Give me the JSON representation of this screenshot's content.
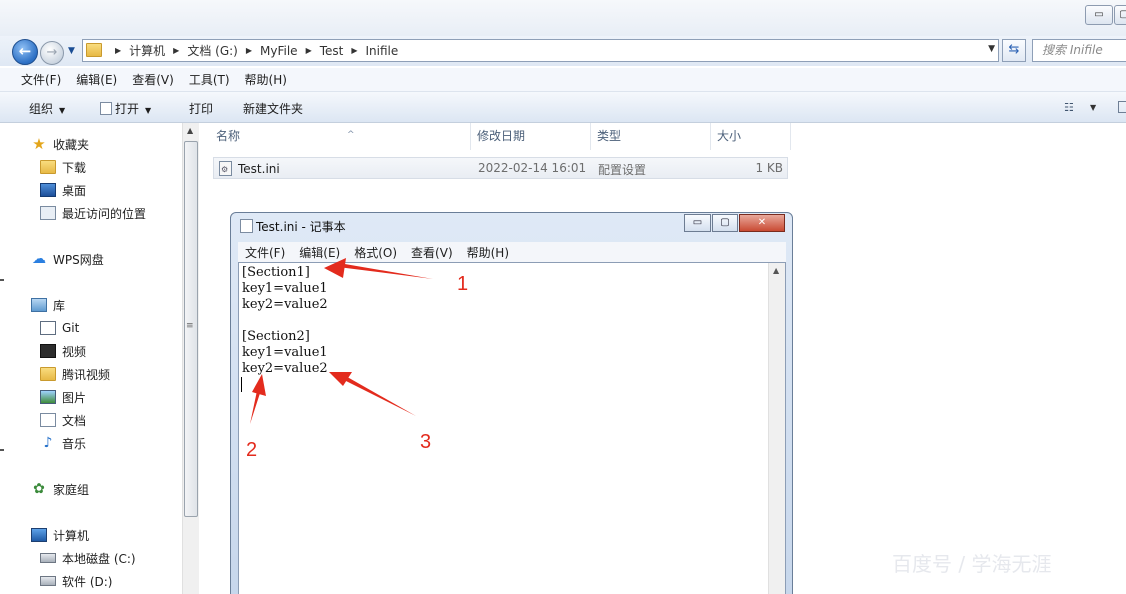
{
  "explorer": {
    "breadcrumb": [
      "计算机",
      "文档 (G:)",
      "MyFile",
      "Test",
      "Inifile"
    ],
    "search_placeholder": "搜索 Inifile",
    "menu": [
      "文件(F)",
      "编辑(E)",
      "查看(V)",
      "工具(T)",
      "帮助(H)"
    ],
    "toolbar": {
      "organize": "组织",
      "open": "打开",
      "print": "打印",
      "new_folder": "新建文件夹"
    },
    "nav": {
      "favorites": "收藏夹",
      "downloads": "下载",
      "desktop": "桌面",
      "recent": "最近访问的位置",
      "wps": "WPS网盘",
      "libraries": "库",
      "git": "Git",
      "video": "视频",
      "tencent_video": "腾讯视频",
      "pictures": "图片",
      "documents": "文档",
      "music": "音乐",
      "homegroup": "家庭组",
      "computer": "计算机",
      "local_disk_c": "本地磁盘 (C:)",
      "software_d": "软件 (D:)"
    },
    "columns": [
      "名称",
      "修改日期",
      "类型",
      "大小"
    ],
    "files": [
      {
        "name": "Test.ini",
        "modified": "2022-02-14 16:01",
        "type": "配置设置",
        "size": "1 KB"
      }
    ]
  },
  "notepad": {
    "title": "Test.ini - 记事本",
    "menu": [
      "文件(F)",
      "编辑(E)",
      "格式(O)",
      "查看(V)",
      "帮助(H)"
    ],
    "lines": [
      "[Section1]",
      "key1=value1",
      "key2=value2",
      "",
      "[Section2]",
      "key1=value1",
      "key2=value2"
    ]
  },
  "annotations": {
    "a1": "1",
    "a2": "2",
    "a3": "3",
    "color": "#e32b1d"
  },
  "watermark": "百度号 / 学海无涯"
}
